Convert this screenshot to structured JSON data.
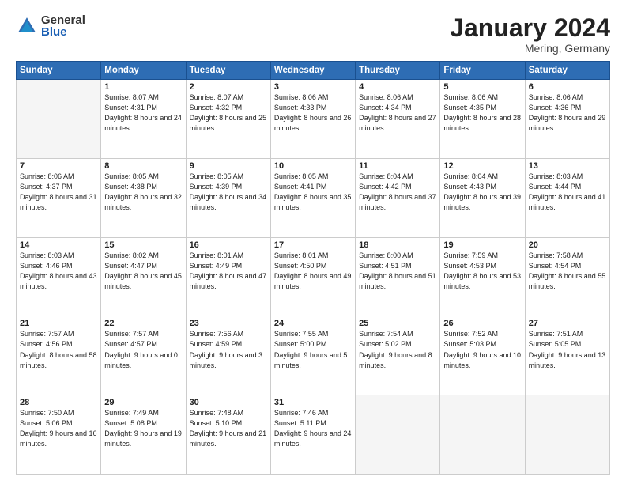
{
  "logo": {
    "general": "General",
    "blue": "Blue"
  },
  "header": {
    "month": "January 2024",
    "location": "Mering, Germany"
  },
  "weekdays": [
    "Sunday",
    "Monday",
    "Tuesday",
    "Wednesday",
    "Thursday",
    "Friday",
    "Saturday"
  ],
  "weeks": [
    [
      {
        "day": "",
        "empty": true
      },
      {
        "day": "1",
        "sunrise": "8:07 AM",
        "sunset": "4:31 PM",
        "daylight": "8 hours and 24 minutes."
      },
      {
        "day": "2",
        "sunrise": "8:07 AM",
        "sunset": "4:32 PM",
        "daylight": "8 hours and 25 minutes."
      },
      {
        "day": "3",
        "sunrise": "8:06 AM",
        "sunset": "4:33 PM",
        "daylight": "8 hours and 26 minutes."
      },
      {
        "day": "4",
        "sunrise": "8:06 AM",
        "sunset": "4:34 PM",
        "daylight": "8 hours and 27 minutes."
      },
      {
        "day": "5",
        "sunrise": "8:06 AM",
        "sunset": "4:35 PM",
        "daylight": "8 hours and 28 minutes."
      },
      {
        "day": "6",
        "sunrise": "8:06 AM",
        "sunset": "4:36 PM",
        "daylight": "8 hours and 29 minutes."
      }
    ],
    [
      {
        "day": "7",
        "sunrise": "8:06 AM",
        "sunset": "4:37 PM",
        "daylight": "8 hours and 31 minutes."
      },
      {
        "day": "8",
        "sunrise": "8:05 AM",
        "sunset": "4:38 PM",
        "daylight": "8 hours and 32 minutes."
      },
      {
        "day": "9",
        "sunrise": "8:05 AM",
        "sunset": "4:39 PM",
        "daylight": "8 hours and 34 minutes."
      },
      {
        "day": "10",
        "sunrise": "8:05 AM",
        "sunset": "4:41 PM",
        "daylight": "8 hours and 35 minutes."
      },
      {
        "day": "11",
        "sunrise": "8:04 AM",
        "sunset": "4:42 PM",
        "daylight": "8 hours and 37 minutes."
      },
      {
        "day": "12",
        "sunrise": "8:04 AM",
        "sunset": "4:43 PM",
        "daylight": "8 hours and 39 minutes."
      },
      {
        "day": "13",
        "sunrise": "8:03 AM",
        "sunset": "4:44 PM",
        "daylight": "8 hours and 41 minutes."
      }
    ],
    [
      {
        "day": "14",
        "sunrise": "8:03 AM",
        "sunset": "4:46 PM",
        "daylight": "8 hours and 43 minutes."
      },
      {
        "day": "15",
        "sunrise": "8:02 AM",
        "sunset": "4:47 PM",
        "daylight": "8 hours and 45 minutes."
      },
      {
        "day": "16",
        "sunrise": "8:01 AM",
        "sunset": "4:49 PM",
        "daylight": "8 hours and 47 minutes."
      },
      {
        "day": "17",
        "sunrise": "8:01 AM",
        "sunset": "4:50 PM",
        "daylight": "8 hours and 49 minutes."
      },
      {
        "day": "18",
        "sunrise": "8:00 AM",
        "sunset": "4:51 PM",
        "daylight": "8 hours and 51 minutes."
      },
      {
        "day": "19",
        "sunrise": "7:59 AM",
        "sunset": "4:53 PM",
        "daylight": "8 hours and 53 minutes."
      },
      {
        "day": "20",
        "sunrise": "7:58 AM",
        "sunset": "4:54 PM",
        "daylight": "8 hours and 55 minutes."
      }
    ],
    [
      {
        "day": "21",
        "sunrise": "7:57 AM",
        "sunset": "4:56 PM",
        "daylight": "8 hours and 58 minutes."
      },
      {
        "day": "22",
        "sunrise": "7:57 AM",
        "sunset": "4:57 PM",
        "daylight": "9 hours and 0 minutes."
      },
      {
        "day": "23",
        "sunrise": "7:56 AM",
        "sunset": "4:59 PM",
        "daylight": "9 hours and 3 minutes."
      },
      {
        "day": "24",
        "sunrise": "7:55 AM",
        "sunset": "5:00 PM",
        "daylight": "9 hours and 5 minutes."
      },
      {
        "day": "25",
        "sunrise": "7:54 AM",
        "sunset": "5:02 PM",
        "daylight": "9 hours and 8 minutes."
      },
      {
        "day": "26",
        "sunrise": "7:52 AM",
        "sunset": "5:03 PM",
        "daylight": "9 hours and 10 minutes."
      },
      {
        "day": "27",
        "sunrise": "7:51 AM",
        "sunset": "5:05 PM",
        "daylight": "9 hours and 13 minutes."
      }
    ],
    [
      {
        "day": "28",
        "sunrise": "7:50 AM",
        "sunset": "5:06 PM",
        "daylight": "9 hours and 16 minutes."
      },
      {
        "day": "29",
        "sunrise": "7:49 AM",
        "sunset": "5:08 PM",
        "daylight": "9 hours and 19 minutes."
      },
      {
        "day": "30",
        "sunrise": "7:48 AM",
        "sunset": "5:10 PM",
        "daylight": "9 hours and 21 minutes."
      },
      {
        "day": "31",
        "sunrise": "7:46 AM",
        "sunset": "5:11 PM",
        "daylight": "9 hours and 24 minutes."
      },
      {
        "day": "",
        "empty": true
      },
      {
        "day": "",
        "empty": true
      },
      {
        "day": "",
        "empty": true
      }
    ]
  ]
}
